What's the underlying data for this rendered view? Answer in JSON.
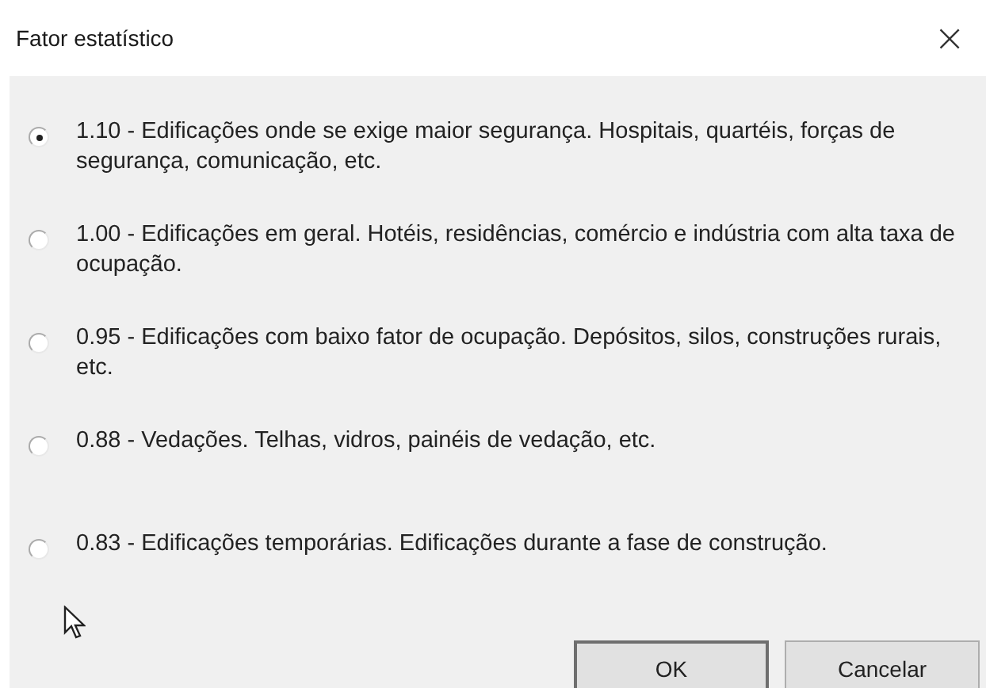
{
  "window": {
    "title": "Fator estatístico",
    "close": "×"
  },
  "options": [
    {
      "label": "1.10 - Edificações onde se exige maior segurança. Hospitais, quartéis, forças de segurança, comunicação, etc.",
      "selected": true
    },
    {
      "label": "1.00 - Edificações em geral. Hotéis, residências, comércio e indústria com alta taxa de ocupação.",
      "selected": false
    },
    {
      "label": "0.95 - Edificações com baixo fator de ocupação. Depósitos, silos, construções rurais, etc.",
      "selected": false
    },
    {
      "label": "0.88 - Vedações. Telhas, vidros, painéis de vedação, etc.",
      "selected": false
    },
    {
      "label": "0.83 - Edificações temporárias. Edificações durante a fase de construção.",
      "selected": false
    }
  ],
  "buttons": [
    {
      "label": "OK",
      "default": true
    },
    {
      "label": "Cancelar",
      "default": false
    }
  ]
}
